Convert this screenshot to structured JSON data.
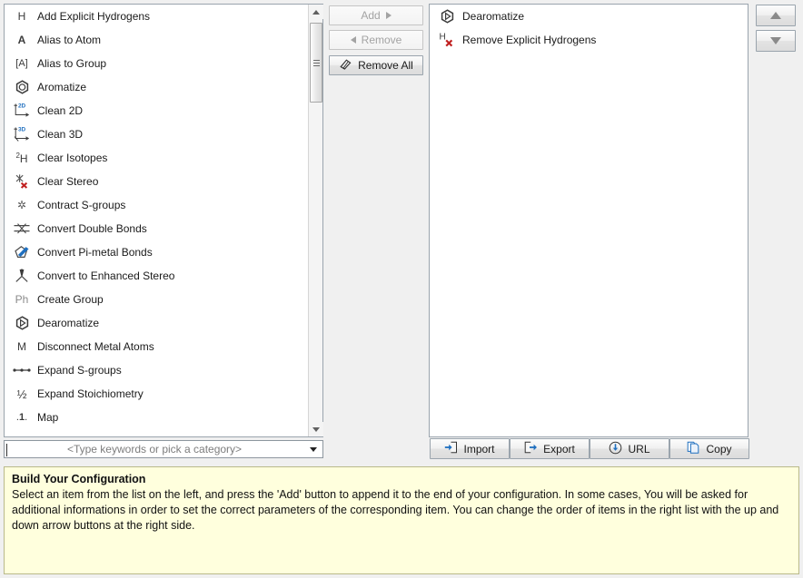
{
  "available_list": {
    "items": [
      {
        "label": "Add Explicit Hydrogens",
        "icon": "hydrogen-letter-icon"
      },
      {
        "label": "Alias to Atom",
        "icon": "atom-letter-icon"
      },
      {
        "label": "Alias to Group",
        "icon": "bracket-atom-icon"
      },
      {
        "label": "Aromatize",
        "icon": "aromatic-ring-icon"
      },
      {
        "label": "Clean 2D",
        "icon": "axes-2d-icon"
      },
      {
        "label": "Clean 3D",
        "icon": "axes-3d-icon"
      },
      {
        "label": "Clear Isotopes",
        "icon": "isotope-icon"
      },
      {
        "label": "Clear Stereo",
        "icon": "clear-stereo-icon"
      },
      {
        "label": "Contract S-groups",
        "icon": "contract-sgroup-icon"
      },
      {
        "label": "Convert Double Bonds",
        "icon": "double-bond-icon"
      },
      {
        "label": "Convert Pi-metal Bonds",
        "icon": "pi-metal-bond-icon"
      },
      {
        "label": "Convert to Enhanced Stereo",
        "icon": "enhanced-stereo-icon"
      },
      {
        "label": "Create Group",
        "icon": "phenyl-label-icon"
      },
      {
        "label": "Dearomatize",
        "icon": "dearomatize-ring-icon"
      },
      {
        "label": "Disconnect Metal Atoms",
        "icon": "metal-letter-icon"
      },
      {
        "label": "Expand S-groups",
        "icon": "expand-sgroup-icon"
      },
      {
        "label": "Expand Stoichiometry",
        "icon": "one-half-fraction-icon"
      },
      {
        "label": "Map",
        "icon": "map-number-icon"
      }
    ]
  },
  "category_filter": {
    "placeholder": "<Type keywords or pick a category>",
    "value": "",
    "arrow_icon": "chevron-down-icon"
  },
  "transfer_buttons": {
    "add_label": "Add",
    "add_icon": "arrow-right-icon",
    "add_enabled": false,
    "remove_label": "Remove",
    "remove_icon": "arrow-left-icon",
    "remove_enabled": false,
    "remove_all_label": "Remove All",
    "remove_all_icon": "eraser-icon",
    "remove_all_enabled": true
  },
  "configuration_list": {
    "items": [
      {
        "label": "Dearomatize",
        "icon": "dearomatize-ring-icon"
      },
      {
        "label": "Remove Explicit Hydrogens",
        "icon": "remove-hydrogen-icon"
      }
    ]
  },
  "order_buttons": {
    "move_up_icon": "arrow-up-icon",
    "move_down_icon": "arrow-down-icon"
  },
  "action_buttons": [
    {
      "label": "Import",
      "icon": "import-icon"
    },
    {
      "label": "Export",
      "icon": "export-icon"
    },
    {
      "label": "URL",
      "icon": "download-circle-icon"
    },
    {
      "label": "Copy",
      "icon": "copy-icon"
    }
  ],
  "help": {
    "title": "Build Your Configuration",
    "body": "Select an item from the list on the left, and press the 'Add' button to append it to the end of your configuration. In some cases, You will be asked for additional informations in order to set the correct parameters of the corresponding item. You can change the order of items in the right list with the up and down arrow buttons at the right side."
  },
  "colors": {
    "panel_bg": "#f0f0f0",
    "list_bg": "#ffffff",
    "border": "#9aa4ad",
    "help_bg": "#ffffdd",
    "help_border": "#b9b98a",
    "accent_blue": "#1f6fbf",
    "accent_red": "#c02020",
    "disabled_text": "#a3a3a3"
  }
}
